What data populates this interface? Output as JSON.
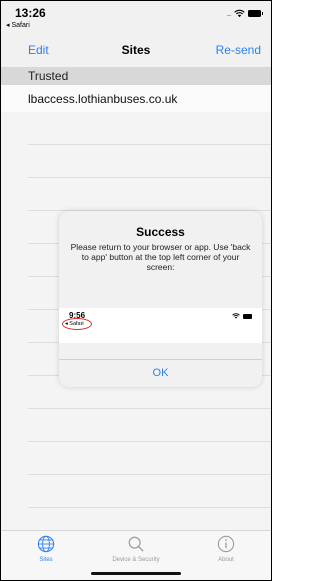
{
  "status_bar": {
    "time": "13:26",
    "back_label": "◂ Safari"
  },
  "nav": {
    "edit_label": "Edit",
    "title": "Sites",
    "resend_label": "Re-send"
  },
  "list": {
    "section_header": "Trusted",
    "items": [
      {
        "label": "lbaccess.lothianbuses.co.uk"
      }
    ]
  },
  "alert": {
    "title": "Success",
    "message": "Please return to your browser or app. Use 'back to app' button at the top left corner of your screen:",
    "preview_time": "9:56",
    "preview_back_label": "◂ Safari",
    "ok_label": "OK"
  },
  "tabs": [
    {
      "label": "Sites",
      "icon": "globe-icon",
      "active": true
    },
    {
      "label": "Device & Security",
      "icon": "search-icon",
      "active": false
    },
    {
      "label": "About",
      "icon": "info-icon",
      "active": false
    }
  ],
  "colors": {
    "accent": "#2f80f0",
    "highlight_circle": "#d32f2f"
  }
}
